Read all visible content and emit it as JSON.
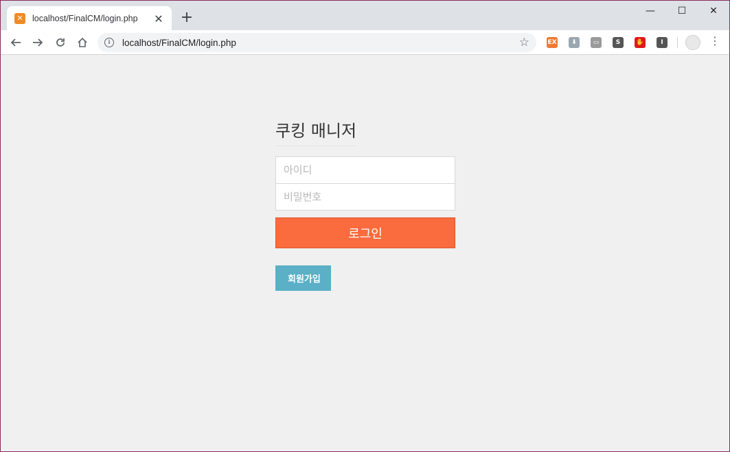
{
  "browser": {
    "tab_title": "localhost/FinalCM/login.php",
    "url": "localhost/FinalCM/login.php",
    "extensions": [
      {
        "name": "ex-extension-icon",
        "label": "EX",
        "color": "#f07a30"
      },
      {
        "name": "download-extension-icon",
        "label": "⬇",
        "color": "#9aa7b0"
      },
      {
        "name": "screen-extension-icon",
        "label": "▭",
        "color": "#9a9a9a"
      },
      {
        "name": "s-extension-icon",
        "label": "S",
        "color": "#555555"
      },
      {
        "name": "adblock-extension-icon",
        "label": "✋",
        "color": "#e0171c"
      },
      {
        "name": "i-extension-icon",
        "label": "I",
        "color": "#555555"
      }
    ]
  },
  "login": {
    "title": "쿠킹 매니저",
    "id_placeholder": "아이디",
    "password_placeholder": "비밀번호",
    "login_label": "로그인",
    "signup_icon": "",
    "signup_label": "회원가입"
  },
  "colors": {
    "login_button": "#fa6c3e",
    "signup_button": "#5bafc6",
    "page_background": "#f0f0f0"
  }
}
